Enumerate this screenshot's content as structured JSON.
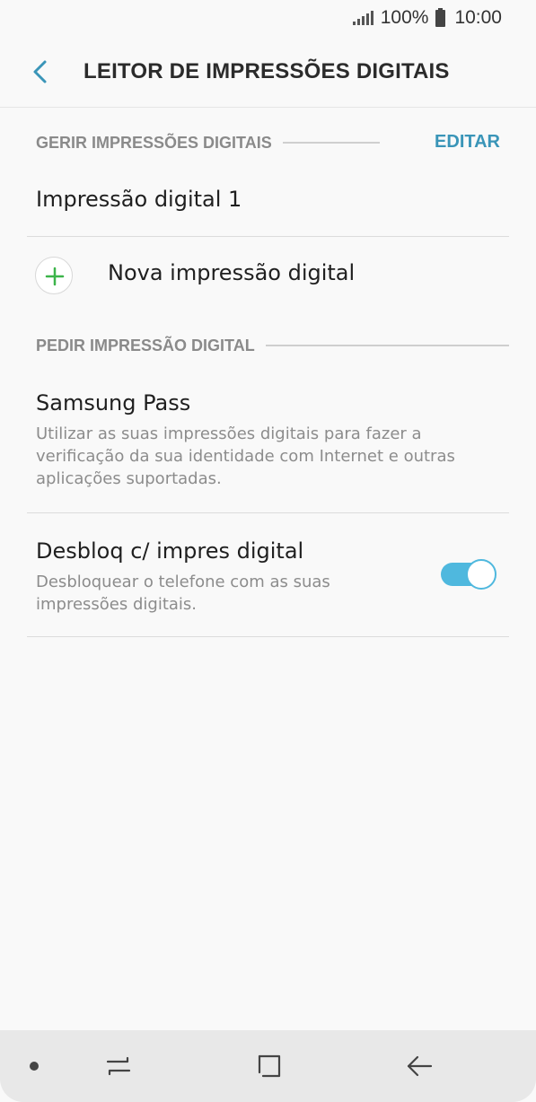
{
  "status_bar": {
    "battery_text": "100%",
    "time": "10:00"
  },
  "header": {
    "title": "LEITOR DE IMPRESSÕES DIGITAIS",
    "back_icon": "chevron-left-icon"
  },
  "manage_section": {
    "label": "GERIR IMPRESSÕES DIGITAIS",
    "edit_label": "EDITAR",
    "fingerprints": [
      "Impressão digital 1"
    ],
    "add_label": "Nova impressão digital"
  },
  "request_section": {
    "label": "PEDIR IMPRESSÃO DIGITAL",
    "samsung_pass": {
      "title": "Samsung Pass",
      "description_lines": [
        "Utilizar as suas impressões digitais para fazer a",
        "verificação da sua identidade com Internet e outras",
        "aplicações suportadas."
      ]
    },
    "unlock": {
      "title": "Desbloq c/ impres digital",
      "description_lines": [
        "Desbloquear o telefone com as suas",
        "impressões digitais."
      ],
      "enabled": true
    }
  },
  "colors": {
    "accent": "#3a95b8",
    "toggle_on": "#4fb8de",
    "plus_green": "#3cb44a"
  }
}
